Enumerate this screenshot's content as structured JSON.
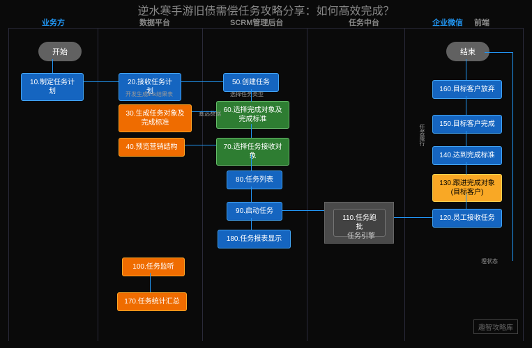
{
  "title": "逆水寒手游旧债需偿任务攻略分享：如何高效完成？",
  "lanes": [
    {
      "label": "业务方",
      "highlight": true
    },
    {
      "label": "数据平台",
      "highlight": false
    },
    {
      "label": "SCRM管理后台",
      "highlight": false
    },
    {
      "label": "任务中台",
      "highlight": false
    },
    {
      "label": "企业微信",
      "highlight": true
    },
    {
      "label": "前端",
      "highlight": false
    }
  ],
  "terminals": {
    "start": "开始",
    "end": "结束"
  },
  "nodes": {
    "n10": "10.制定任务计划",
    "n20": "20.接收任务计划",
    "n30": "30.生成任务对象及完成标准",
    "n40": "40.预览营销结构",
    "n50": "50.创建任务",
    "n60": "60.选择完成对象及完成标准",
    "n70": "70.选择任务接收对象",
    "n80": "80.任务列表",
    "n90": "90.启动任务",
    "n100": "100.任务监听",
    "n110": "110.任务跑批",
    "n120": "120.员工接收任务",
    "n130": "130.跟进完成对象(目标客户)",
    "n140": "140.达到完成标准",
    "n150": "150.目标客户完成",
    "n160": "160.目标客户放弃",
    "n170": "170.任务统计汇总",
    "n180": "180.任务报表显示"
  },
  "engine_label": "任务引擎",
  "annotations": {
    "link_gen": "开发生成link结果表",
    "select_type": "选择任务类型",
    "select_data": "塞选数据",
    "task_fulfil": "任务履行",
    "status_bury": "埋状态"
  },
  "watermark": "趣智攻略库"
}
